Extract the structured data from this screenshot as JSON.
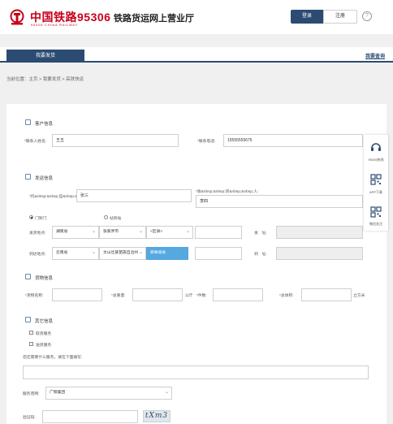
{
  "header": {
    "logo_cn": "中国铁路95306",
    "logo_en": "95306 CHINA RAILWAY",
    "site_title": "铁路货运网上营业厅",
    "login_label": "登录",
    "register_label": "注册",
    "help_symbol": "?"
  },
  "nav": {
    "active_tab": "我要发货",
    "query_link": "我要查询"
  },
  "breadcrumb": "当前位置：主页 > 我要发货 > 高铁快运",
  "customer": {
    "section_title": "客户信息",
    "contact_label": "联系人姓名:",
    "contact_value": "王五",
    "phone_label": "联系电话:",
    "phone_value": "15555555675"
  },
  "shipping": {
    "section_title": "发运信息",
    "shipper_label": "托&nbsp;&nbsp;运&nbsp;&nbsp;人:",
    "shipper_value": "张三",
    "receiver_label": "收&nbsp;&nbsp;货&nbsp;&nbsp;人:",
    "receiver_value": "李四",
    "radio1_label": "门到门",
    "radio2_label": "站到站",
    "origin_label": "发货地点:",
    "origin_province": "湖南省",
    "origin_city": "张家界市",
    "origin_district": "<区县>",
    "origin_detail_label": "发　址:",
    "dest_label": "到达地点:",
    "dest_province": "云南省",
    "dest_city": "文山壮族苗族自治州",
    "dest_district": "麻栗坡县",
    "dest_detail_label": "到　址:"
  },
  "cargo": {
    "section_title": "货物信息",
    "name_label": "货物名称:",
    "weight_label": "总重量:",
    "weight_unit": "公斤",
    "count_label": "件数:",
    "volume_label": "总体积:",
    "volume_unit": "立方米"
  },
  "other": {
    "section_title": "其它信息",
    "option1": "取货服务",
    "option2": "送货服务",
    "note_label": "您还需要什么服务，请在下面填写:",
    "service_label": "服务营网:",
    "service_value": "广铁集团",
    "captcha_label": "验证码:",
    "captcha_value": "tXm3"
  },
  "side": {
    "hotline": "95306热线",
    "app": "APP下载",
    "wechat": "微信关注"
  },
  "colors": {
    "brand_red": "#c7001b",
    "nav_blue": "#2b4b72",
    "highlight": "#55a8e0"
  }
}
